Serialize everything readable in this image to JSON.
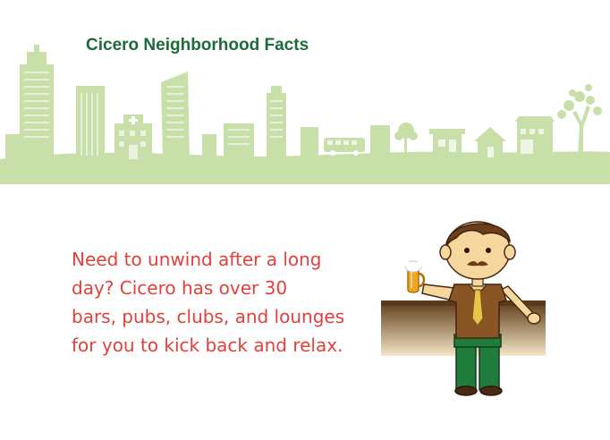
{
  "header": {
    "title": "Cicero Neighborhood Facts"
  },
  "fact": {
    "lines": [
      "Need to unwind after a long",
      "day? Cicero has over 30",
      "bars, pubs, clubs, and lounges",
      "for you to kick back and relax."
    ]
  },
  "colors": {
    "title": "#1e6b3a",
    "fact_text": "#e2403b",
    "skyline": "#c9dfa9",
    "skyline_detail": "#ffffff",
    "bar_counter": "#c5a46c",
    "shirt": "#8a5525",
    "pants": "#1f7d3b",
    "tie": "#e9c44a",
    "skin": "#f6d79e"
  },
  "illustration": {
    "skyline_icons": [
      "office-building-icon",
      "hospital-icon",
      "bus-icon",
      "tree-icon",
      "shop-icon",
      "house-icon"
    ],
    "character_icons": [
      "man-icon",
      "beer-mug-icon",
      "bar-counter-icon"
    ]
  }
}
